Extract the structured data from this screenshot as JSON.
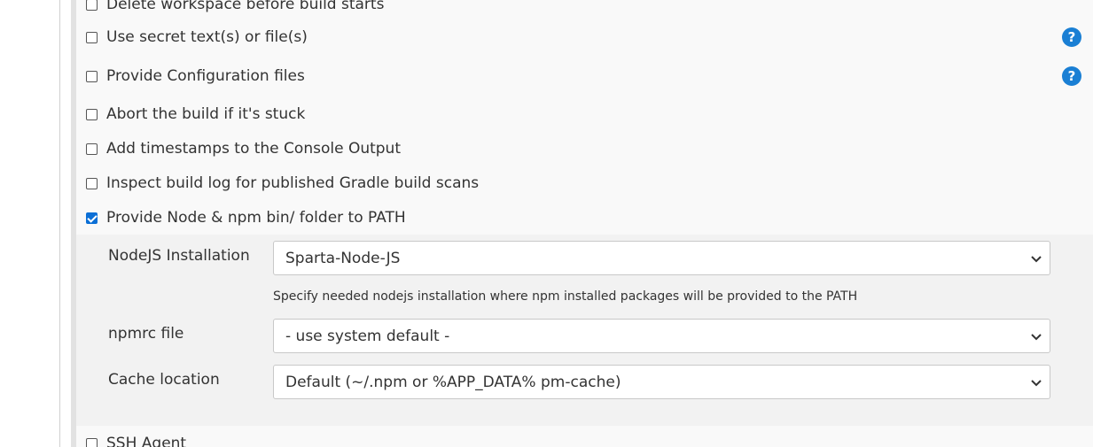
{
  "options": {
    "delete_workspace": {
      "label": "Delete workspace before build starts",
      "checked": false
    },
    "use_secret": {
      "label": "Use secret text(s) or file(s)",
      "checked": false
    },
    "provide_config": {
      "label": "Provide Configuration files",
      "checked": false
    },
    "abort_stuck": {
      "label": "Abort the build if it's stuck",
      "checked": false
    },
    "timestamps": {
      "label": "Add timestamps to the Console Output",
      "checked": false
    },
    "gradle_scans": {
      "label": "Inspect build log for published Gradle build scans",
      "checked": false
    },
    "node_path": {
      "label": "Provide Node & npm bin/ folder to PATH",
      "checked": true
    },
    "ssh_agent": {
      "label": "SSH Agent",
      "checked": false
    }
  },
  "help_icon_glyph": "?",
  "node_config": {
    "nodejs_installation": {
      "label": "NodeJS Installation",
      "value": "Sparta-Node-JS",
      "hint": "Specify needed nodejs installation where npm installed packages will be provided to the PATH"
    },
    "npmrc_file": {
      "label": "npmrc file",
      "value": "- use system default -"
    },
    "cache_location": {
      "label": "Cache location",
      "value": "Default (~/.npm or %APP_DATA% pm-cache)"
    }
  },
  "colors": {
    "accent": "#0b6fd6",
    "help_icon": "#1a7fd4",
    "panel_bg": "#f9f9f9",
    "sub_panel_bg": "#f2f2f2"
  }
}
